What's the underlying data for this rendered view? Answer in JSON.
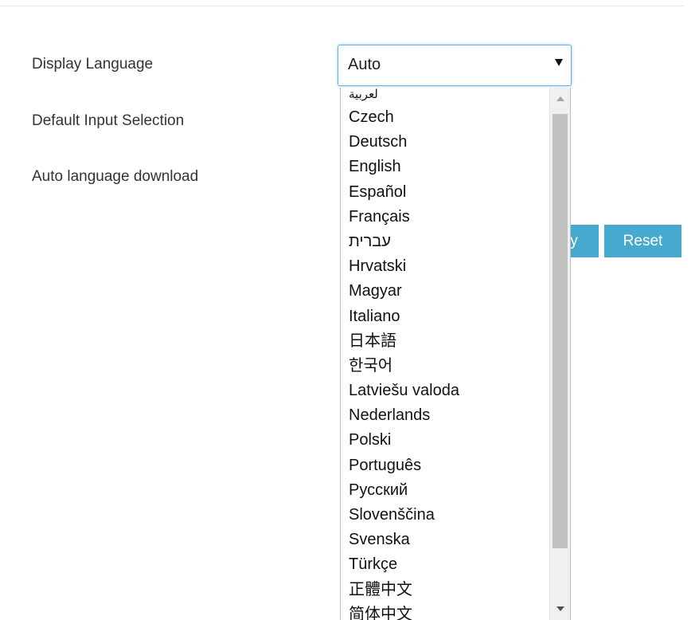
{
  "settings": {
    "display_language_label": "Display Language",
    "default_input_label": "Default Input Selection",
    "auto_download_label": "Auto language download"
  },
  "language_select": {
    "selected": "Auto",
    "options": [
      "لعربية",
      "Czech",
      "Deutsch",
      "English",
      "Español",
      "Français",
      "עברית",
      "Hrvatski",
      "Magyar",
      "Italiano",
      "日本語",
      "한국어",
      "Latviešu valoda",
      "Nederlands",
      "Polski",
      "Português",
      "Русский",
      "Slovenščina",
      "Svenska",
      "Türkçe",
      "正體中文",
      "简体中文"
    ]
  },
  "buttons": {
    "apply_label_visible": "y",
    "reset_label": "Reset"
  },
  "colors": {
    "button_bg": "#48a9cf",
    "focus_border": "#66afe9",
    "scroll_thumb": "#c1c1c1"
  }
}
